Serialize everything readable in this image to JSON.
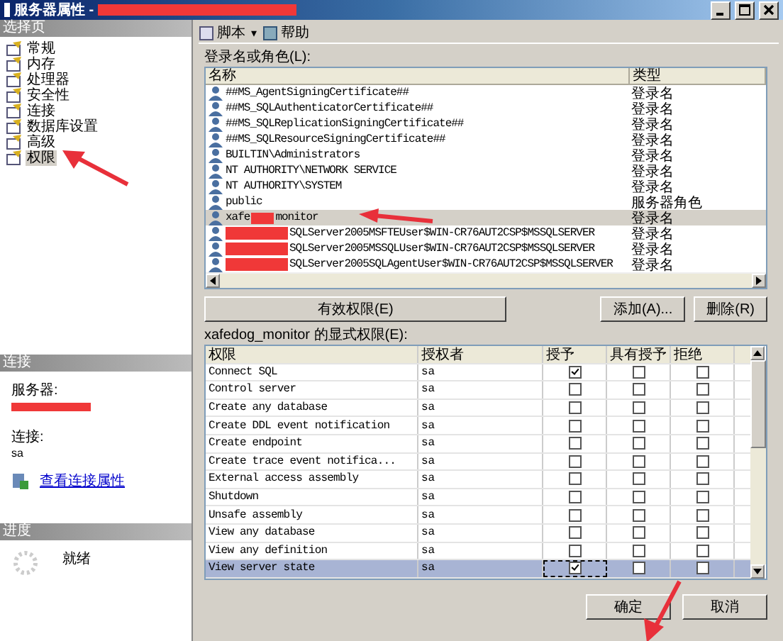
{
  "window": {
    "title": "服务器属性 - ",
    "title_redacted": true
  },
  "select_page": {
    "header": "选择页",
    "items": [
      {
        "label": "常规",
        "selected": false
      },
      {
        "label": "内存",
        "selected": false
      },
      {
        "label": "处理器",
        "selected": false
      },
      {
        "label": "安全性",
        "selected": false
      },
      {
        "label": "连接",
        "selected": false
      },
      {
        "label": "数据库设置",
        "selected": false
      },
      {
        "label": "高级",
        "selected": false
      },
      {
        "label": "权限",
        "selected": true
      }
    ]
  },
  "connection": {
    "header": "连接",
    "server_label": "服务器:",
    "server_redacted": true,
    "connection_label": "连接:",
    "connection_value": "sa",
    "link": "查看连接属性"
  },
  "progress": {
    "header": "进度",
    "status": "就绪"
  },
  "toolbar": {
    "script": "脚本",
    "caret": "▾",
    "help": "帮助"
  },
  "logins": {
    "label": "登录名或角色(L):",
    "columns": [
      "名称",
      "类型"
    ],
    "rows": [
      {
        "name": "##MS_AgentSigningCertificate##",
        "type": "登录名",
        "selected": false
      },
      {
        "name": "##MS_SQLAuthenticatorCertificate##",
        "type": "登录名",
        "selected": false
      },
      {
        "name": "##MS_SQLReplicationSigningCertificate##",
        "type": "登录名",
        "selected": false
      },
      {
        "name": "##MS_SQLResourceSigningCertificate##",
        "type": "登录名",
        "selected": false
      },
      {
        "name": "BUILTIN\\Administrators",
        "type": "登录名",
        "selected": false
      },
      {
        "name": "NT AUTHORITY\\NETWORK SERVICE",
        "type": "登录名",
        "selected": false
      },
      {
        "name": "NT AUTHORITY\\SYSTEM",
        "type": "登录名",
        "selected": false
      },
      {
        "name": "public",
        "type": "服务器角色",
        "selected": false
      },
      {
        "name": "xafe",
        "redacted": true,
        "name_after": "monitor",
        "type": "登录名",
        "selected": true
      },
      {
        "redacted": true,
        "name_after": "SQLServer2005MSFTEUser$WIN-CR76AUT2CSP$MSSQLSERVER",
        "type": "登录名",
        "selected": false
      },
      {
        "redacted": true,
        "name_after": "SQLServer2005MSSQLUser$WIN-CR76AUT2CSP$MSSQLSERVER",
        "type": "登录名",
        "selected": false
      },
      {
        "redacted": true,
        "name_after": "SQLServer2005SQLAgentUser$WIN-CR76AUT2CSP$MSSQLSERVER",
        "type": "登录名",
        "selected": false
      }
    ]
  },
  "buttons": {
    "effective": "有效权限(E)",
    "add": "添加(A)...",
    "remove": "删除(R)"
  },
  "permissions": {
    "label": "xafedog_monitor 的显式权限(E):",
    "columns": [
      "权限",
      "授权者",
      "授予",
      "具有授予",
      "拒绝"
    ],
    "rows": [
      {
        "permission": "Connect SQL",
        "grantor": "sa",
        "grant": true,
        "with_grant": false,
        "deny": false,
        "selected": false
      },
      {
        "permission": "Control server",
        "grantor": "sa",
        "grant": false,
        "with_grant": false,
        "deny": false,
        "selected": false
      },
      {
        "permission": "Create any database",
        "grantor": "sa",
        "grant": false,
        "with_grant": false,
        "deny": false,
        "selected": false
      },
      {
        "permission": "Create DDL event notification",
        "grantor": "sa",
        "grant": false,
        "with_grant": false,
        "deny": false,
        "selected": false
      },
      {
        "permission": "Create endpoint",
        "grantor": "sa",
        "grant": false,
        "with_grant": false,
        "deny": false,
        "selected": false
      },
      {
        "permission": "Create trace event notifica...",
        "grantor": "sa",
        "grant": false,
        "with_grant": false,
        "deny": false,
        "selected": false
      },
      {
        "permission": "External access assembly",
        "grantor": "sa",
        "grant": false,
        "with_grant": false,
        "deny": false,
        "selected": false
      },
      {
        "permission": "Shutdown",
        "grantor": "sa",
        "grant": false,
        "with_grant": false,
        "deny": false,
        "selected": false
      },
      {
        "permission": "Unsafe assembly",
        "grantor": "sa",
        "grant": false,
        "with_grant": false,
        "deny": false,
        "selected": false
      },
      {
        "permission": "View any database",
        "grantor": "sa",
        "grant": false,
        "with_grant": false,
        "deny": false,
        "selected": false
      },
      {
        "permission": "View any definition",
        "grantor": "sa",
        "grant": false,
        "with_grant": false,
        "deny": false,
        "selected": false
      },
      {
        "permission": "View server state",
        "grantor": "sa",
        "grant": true,
        "with_grant": false,
        "deny": false,
        "selected": true
      }
    ]
  },
  "footer": {
    "ok": "确定",
    "cancel": "取消"
  }
}
